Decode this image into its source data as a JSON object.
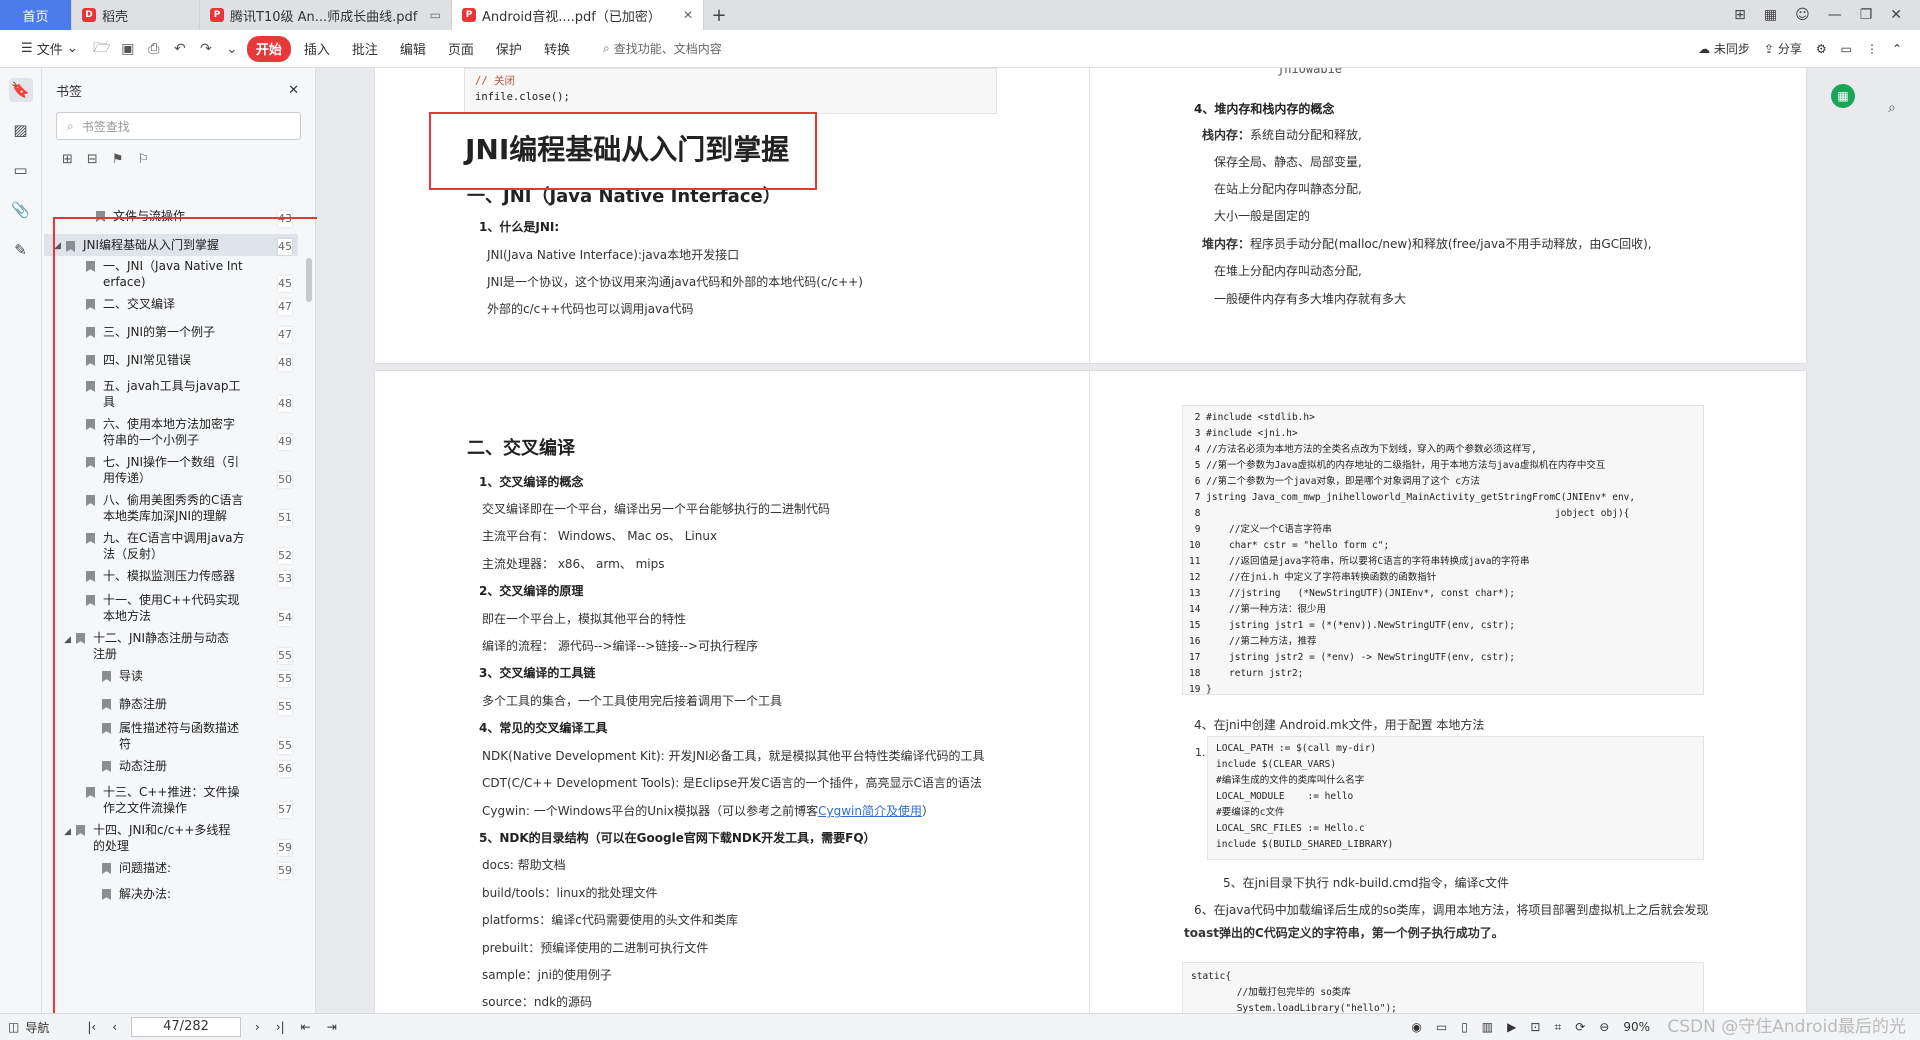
{
  "tabs": [
    {
      "label": "首页"
    },
    {
      "label": "稻壳"
    },
    {
      "label": "腾讯T10级 An...师成长曲线.pdf"
    },
    {
      "label": "Android音视....pdf（已加密）"
    }
  ],
  "toolbar": {
    "file": "文件",
    "start": "开始",
    "insert": "插入",
    "annotate": "批注",
    "edit": "编辑",
    "page": "页面",
    "protect": "保护",
    "convert": "转换",
    "search": "查找功能、文档内容",
    "sync": "未同步",
    "share": "分享"
  },
  "bookmarks": {
    "title": "书签",
    "search_placeholder": "书签查找",
    "items": [
      {
        "label": "文件与流操作",
        "page": "43"
      },
      {
        "label": "JNI编程基础从入门到掌握",
        "page": "45"
      },
      {
        "label": "一、JNI（Java Native Int",
        "label2": "erface)",
        "page": "45"
      },
      {
        "label": "二、交叉编译",
        "page": "47"
      },
      {
        "label": "三、JNI的第一个例子",
        "page": "47"
      },
      {
        "label": "四、JNI常见错误",
        "page": "48"
      },
      {
        "label": "五、javah工具与javap工",
        "label2": "具",
        "page": "48"
      },
      {
        "label": "六、使用本地方法加密字",
        "label2": "符串的一个小例子",
        "page": "49"
      },
      {
        "label": "七、JNI操作一个数组（引",
        "label2": "用传递）",
        "page": "50"
      },
      {
        "label": "八、偷用美图秀秀的C语言",
        "label2": "本地类库加深JNI的理解",
        "page": "51"
      },
      {
        "label": "九、在C语言中调用java方",
        "label2": "法（反射）",
        "page": "52"
      },
      {
        "label": "十、模拟监测压力传感器",
        "page": "53"
      },
      {
        "label": "十一、使用C++代码实现",
        "label2": "本地方法",
        "page": "54"
      },
      {
        "label": "十二、JNI静态注册与动态",
        "label2": "注册",
        "page": "55"
      },
      {
        "label": "导读",
        "page": "55"
      },
      {
        "label": "静态注册",
        "page": "55"
      },
      {
        "label": "属性描述符与函数描述",
        "label2": "符",
        "page": "55"
      },
      {
        "label": "动态注册",
        "page": "56"
      },
      {
        "label": "十三、C++推进：文件操",
        "label2": "作之文件流操作",
        "page": "57"
      },
      {
        "label": "十四、JNI和c/c++多线程",
        "label2": "的处理",
        "page": "59"
      },
      {
        "label": "问题描述:",
        "page": "59"
      },
      {
        "label": "解决办法:",
        "page": ""
      }
    ]
  },
  "doc": {
    "code_top": [
      "// 关闭",
      "infile.close();"
    ],
    "title": "JNI编程基础从入门到掌握",
    "s1": "一、JNI（Java Native Interface）",
    "s1_1": "1、什么是JNI:",
    "s1_t1": "JNI(Java Native Interface):java本地开发接口",
    "s1_t2": "JNI是一个协议，这个协议用来沟通java代码和外部的本地代码(c/c++)",
    "s1_t3": "外部的c/c++代码也可以调用java代码",
    "r_top": "jniowabie",
    "r_h4": "4、堆内存和栈内存的概念",
    "r_stack": "栈内存：",
    "r_stack_t": "系统自动分配和释放,",
    "r_l1": "保存全局、静态、局部变量,",
    "r_l2": "在站上分配内存叫静态分配,",
    "r_l3": "大小一般是固定的",
    "r_heap": "堆内存：",
    "r_heap_t": "程序员手动分配(malloc/new)和释放(free/java不用手动释放，由GC回收),",
    "r_l4": "在堆上分配内存叫动态分配,",
    "r_l5": "一般硬件内存有多大堆内存就有多大",
    "s2": "二、交叉编译",
    "s2_1": "1、交叉编译的概念",
    "s2_1a": "交叉编译即在一个平台，编译出另一个平台能够执行的二进制代码",
    "s2_1b": "主流平台有： Windows、 Mac os、 Linux",
    "s2_1c": "主流处理器： x86、 arm、 mips",
    "s2_2": "2、交叉编译的原理",
    "s2_2a": "即在一个平台上，模拟其他平台的特性",
    "s2_2b": "编译的流程： 源代码-->编译-->链接-->可执行程序",
    "s2_3": "3、交叉编译的工具链",
    "s2_3a": "多个工具的集合，一个工具使用完后接着调用下一个工具",
    "s2_4": "4、常见的交叉编译工具",
    "s2_4a": "NDK(Native Development Kit): 开发JNI必备工具，就是模拟其他平台特性类编译代码的工具",
    "s2_4b": "CDT(C/C++ Development Tools): 是Eclipse开发C语言的一个插件，高亮显示C语言的语法",
    "s2_4c": "Cygwin: 一个Windows平台的Unix模拟器（可以参考之前博客",
    "s2_4c_link": "Cygwin简介及使用",
    "s2_4c_end": "）",
    "s2_5": "5、NDK的目录结构（可以在Google官网下载NDK开发工具，需要FQ）",
    "s2_5a": "docs: 帮助文档",
    "s2_5b": "build/tools：linux的批处理文件",
    "s2_5c": "platforms：编译c代码需要使用的头文件和类库",
    "s2_5d": "prebuilt：预编译使用的二进制可执行文件",
    "s2_5e": "sample：jni的使用例子",
    "s2_5f": "source：ndk的源码",
    "code_mid": [
      " 2 #include <stdlib.h>",
      " 3 #include <jni.h>",
      " 4 //方法名必须为本地方法的全类名点改为下划线，穿入的两个参数必须这样写,",
      " 5 //第一个参数为Java虚拟机的内存地址的二级指针，用于本地方法与java虚拟机在内存中交互",
      " 6 //第二个参数为一个java对象，即是哪个对象调用了这个 c方法",
      " 7 jstring Java_com_mwp_jnihelloworld_MainActivity_getStringFromC(JNIEnv* env,",
      " 8                                                              jobject obj){",
      " 9     //定义一个C语言字符串",
      "10     char* cstr = \"hello form c\";",
      "11     //返回值是java字符串，所以要将C语言的字符串转换成java的字符串",
      "12     //在jni.h 中定义了字符串转换函数的函数指针",
      "13     //jstring   (*NewStringUTF)(JNIEnv*, const char*);",
      "14     //第一种方法：很少用",
      "15     jstring jstr1 = (*(*env)).NewStringUTF(env, cstr);",
      "16     //第二种方法，推荐",
      "17     jstring jstr2 = (*env) -> NewStringUTF(env, cstr);",
      "18     return jstr2;",
      "19 }"
    ],
    "r4": "4、在jni中创建 Android.mk文件，用于配置 本地方法",
    "code_mk_no": "1.",
    "code_mk": [
      "LOCAL_PATH := $(call my-dir)",
      "include $(CLEAR_VARS)",
      "#编译生成的文件的类库叫什么名字",
      "LOCAL_MODULE    := hello",
      "#要编译的c文件",
      "LOCAL_SRC_FILES := Hello.c",
      "include $(BUILD_SHARED_LIBRARY)"
    ],
    "r5": "5、在jni目录下执行 ndk-build.cmd指令，编译c文件",
    "r6a": "6、在java代码中加载编译后生成的so类库，调用本地方法，将项目部署到虚拟机上之后就会发现",
    "r6b": "toast弹出的C代码定义的字符串，第一个例子执行成功了。",
    "code_bot": [
      "static{",
      "        //加载打包完毕的 so类库",
      "        System.loadLibrary(\"hello\");"
    ]
  },
  "status": {
    "nav": "导航",
    "page": "47/282",
    "zoom": "90%",
    "watermark": "CSDN @守住Android最后的光"
  }
}
